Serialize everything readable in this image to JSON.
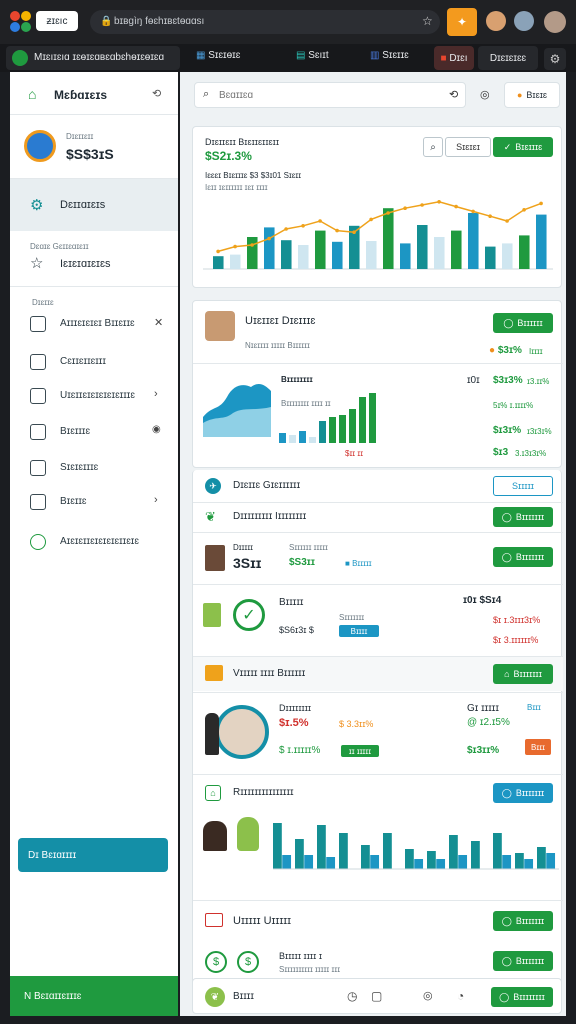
{
  "browser": {
    "tab_title": "ƶɪɛıc",
    "address": "bɪʙgìŋ fɵɛhɪʙɛtɵɑɑsı",
    "tabs": [
      "Mɪɛıɪɛıɑ ɪɛɵɪɛɑʙɛɑbɛhɵɪɛɵɪɛɑ",
      "Sɪɛɪɵɪɛ",
      "Sɛıɪt",
      "Sɪɛɪɪɛ",
      "Dɪɛı",
      "Dɪɛɪɛɪɛɛ"
    ]
  },
  "sidebar": {
    "header": "Mɛɓɑɪɛɪs",
    "profile_label": "Dɪɛɪɪɛɪɪ",
    "profile_value": "$S$3ɪS",
    "active_item": "Dɛɪɪɑɪɛɪs",
    "section_label": "Dɛɑɪɛ Gɛɪɪɛɑɪɛɪɪ",
    "starred_item": "Iɛɪɛɪɑɪɛɪɛs",
    "group_label": "Dɪɛɪɪɛ",
    "items": [
      {
        "label": "Aɪɪɪɛɪɛɪɛɪ Bɪɪɛɪɪɛ"
      },
      {
        "label": "Cɛɪɪɛɪɪɛɪɪɪ"
      },
      {
        "label": "Uɪɛɪɪɛɪɛɪɛɪɛɪɛɪɪɪɛ"
      },
      {
        "label": "Bɪɛɪɪɪɛ"
      },
      {
        "label": "Sɪɛɪɛɪɪɪɛ"
      },
      {
        "label": "Bɪɛɪɪɛ"
      },
      {
        "label": "Aɪɛɪɛɪɪɛɪɛɪɛɪɛɪɪɛɪɛ"
      }
    ],
    "teal_button": "Dɪ Bɛɪɑɪɪɪɪ",
    "green_button": "N Bɛɪɑɪɪɛɪɪɪɛ"
  },
  "search": {
    "placeholder": "Bɛɑɪɪɛɑ"
  },
  "profile_btn": "Bɪɛɪɛ",
  "chart_card": {
    "title": "Dɪɛɪɪɛɪɪ Bɪɛɪɪɛɪɪɛɪɪ",
    "value": "$S2ɪ.3%",
    "sub": "Iɛɛɛɪ Bɪɛɪɪɪɛ   $3   $3ɪ01 Sɪɛɪɪ",
    "sub2": "Iɛɪɪ ɪɛɪɪɪɪɪɪ ɪɛɪ ɪɪɪɪ",
    "outline_btn": "Sɪɛɪɛɪ",
    "green_btn": "Bɪɛɪɪɪɛ"
  },
  "chart_data": {
    "type": "bar",
    "categories": [
      "",
      "",
      "",
      "",
      "",
      "",
      "",
      "",
      "",
      "",
      "",
      "",
      "",
      "",
      "",
      "",
      "",
      "",
      "",
      ""
    ],
    "series": [
      {
        "values": [
          16,
          18,
          40,
          52,
          36,
          30,
          48,
          34,
          54,
          35,
          76,
          32,
          55,
          40,
          48,
          70,
          28,
          32,
          42,
          68
        ]
      },
      {
        "values": [
          10,
          0,
          0,
          0,
          0,
          0,
          0,
          0,
          0,
          0,
          0,
          0,
          0,
          0,
          0,
          0,
          0,
          0,
          0,
          0
        ]
      }
    ],
    "line": [
      22,
      28,
      30,
      38,
      50,
      54,
      60,
      48,
      46,
      62,
      70,
      76,
      80,
      84,
      78,
      72,
      66,
      60,
      74,
      82
    ]
  },
  "detail_card": {
    "name": "Uɪɛɪɪɛɪ Dɪɛɪɪɪɛ",
    "sub": "Nɪɛɪɪɪɪ ɪɪɪɪɪ Bɪɪɪɪɪɪ",
    "btn": "Bɪɪɪɪɪɪ",
    "badge_value": "$3ɪ%",
    "badge_label": "Iɪɪɪɪ",
    "mini_title": "Bɪɪɪɪɪɪɪɪ",
    "mini_sub": "Bɪɪɪɪɪɪɪɪ ɪɪɪɪ ɪɪ",
    "right_values": [
      {
        "label": "ɪ0ɪ",
        "value": "$3ɪ3%",
        "extra": "ɪ3.ɪɪ%"
      },
      {
        "label": "",
        "value": "",
        "extra": "5ɪ% ɪ.ɪɪɪɪ%"
      },
      {
        "label": "",
        "value": "$ɪ3ɪ%",
        "extra": "ɪ3ɪ3ɪ%"
      },
      {
        "label": "",
        "value": "$ɪ3",
        "extra": "3.ɪ3ɪ3ɪ%"
      }
    ]
  },
  "rows": [
    {
      "title": "Dɪɛɪɪɛ Gɪɛɪɪɪɪɪɪ",
      "btn": "Sɪɪɪɪɪ"
    },
    {
      "title": "Dɪɪɪɪɪɪɪɪɪ Iɪɪɪɪɪɪɪɪ",
      "btn": "Bɪɪɪɪɪɪɪ"
    },
    {
      "title": "Dɪɪɪɪɪ",
      "v1": "3Sɪɪ",
      "v2": "$S3ɪɪ",
      "v3": "Bɪɪɪɪɪ",
      "sub": "Sɪɪɪɪɪɪ ɪɪɪɪɪ",
      "btn": "Bɪɪɪɪɪɪɪ"
    },
    {
      "title": "Bɪɪɪɪɪ",
      "sub": "$S6ɪ3ɪ $",
      "sub2": "Sɪɪɪɪɪɪɪ",
      "pill": "Bɪɪɪɪ",
      "right": "ɪ0ɪ   $Sɪ4",
      "r1": "$ɪ  ɪ.3ɪɪɪ3ɪ%",
      "r2": "$ɪ  3.ɪɪɪɪɪɪ%"
    },
    {
      "title": "Vɪɪɪɪɪ ɪɪɪɪ Bɪɪɪɪɪɪ",
      "btn": "Bɪɪɪɪɪɪɪ"
    },
    {
      "title": "Dɪɪɪɪɪɪɪɪ",
      "v1": "$ɪ.5%",
      "v2": "$ 3.3ɪɪ%",
      "v3": "$ ɪ.ɪɪɪɪɪ%",
      "pill": "ɪɪ ɪɪɪɪɪ",
      "right1": "Gɪ ɪɪɪɪɪ",
      "right2": "@ ɪ2.ɪ5%",
      "right3": "$ɪ3ɪɪ%",
      "tag": "Bɪɪɪ",
      "tag2": "Bɪɪɪ"
    },
    {
      "title": "Rɪɪɪɪɪɪɪɪɪɪɪɪɪɪɪ",
      "btn": "Bɪɪɪɪɪɪɪ"
    },
    {
      "title": "Uɪɪɪɪɪ Uɪɪɪɪɪ",
      "btn": "Bɪɪɪɪɪɪɪ",
      "sub": "Bɪɪɪɪɪ ɪɪɪɪ ɪ",
      "sub2": "Sɪɪɪɪɪɪɪɪɪɪ ɪɪɪɪɪ ɪɪɪ",
      "btn2": "Bɪɪɪɪɪɪɪ"
    },
    {
      "title": "Bɪɪɪɪ",
      "btn": "Bɪɪɪɪɪɪɪɪ"
    }
  ],
  "bottom_chart": {
    "values": [
      46,
      30,
      44,
      36,
      24,
      36,
      20,
      18,
      34,
      28,
      36,
      16,
      22
    ],
    "values2": [
      14,
      14,
      12,
      0,
      14,
      0,
      10,
      10,
      14,
      0,
      14,
      10,
      16
    ]
  },
  "colors": {
    "green": "#1f9a3f",
    "teal": "#148f93",
    "blue": "#1c96c4",
    "light": "#cfe6f0",
    "orange": "#efa21b"
  }
}
